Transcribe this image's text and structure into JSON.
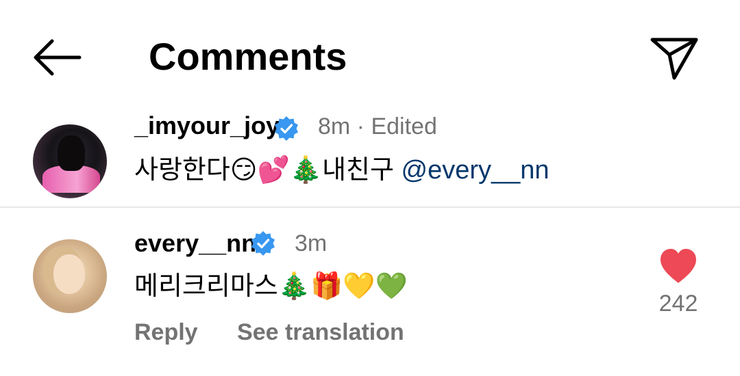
{
  "header": {
    "title": "Comments"
  },
  "comments": [
    {
      "username": "_imyour_joy",
      "meta": "8m · Edited",
      "text": "사랑한다😏💕🎄내친구 ",
      "mention": "@every__nn"
    },
    {
      "username": "every__nn",
      "meta": "3m",
      "text": "메리크리마스🎄🎁💛💚",
      "like_count": "242",
      "actions": {
        "reply": "Reply",
        "translate": "See translation"
      }
    }
  ],
  "icons": {
    "back": "arrow-left-icon",
    "share": "paper-plane-icon",
    "verified": "verified-badge-icon",
    "like": "heart-icon"
  },
  "colors": {
    "verified": "#3897f0",
    "heart": "#ed4956",
    "mention": "#00376b",
    "secondary_text": "#737373"
  }
}
